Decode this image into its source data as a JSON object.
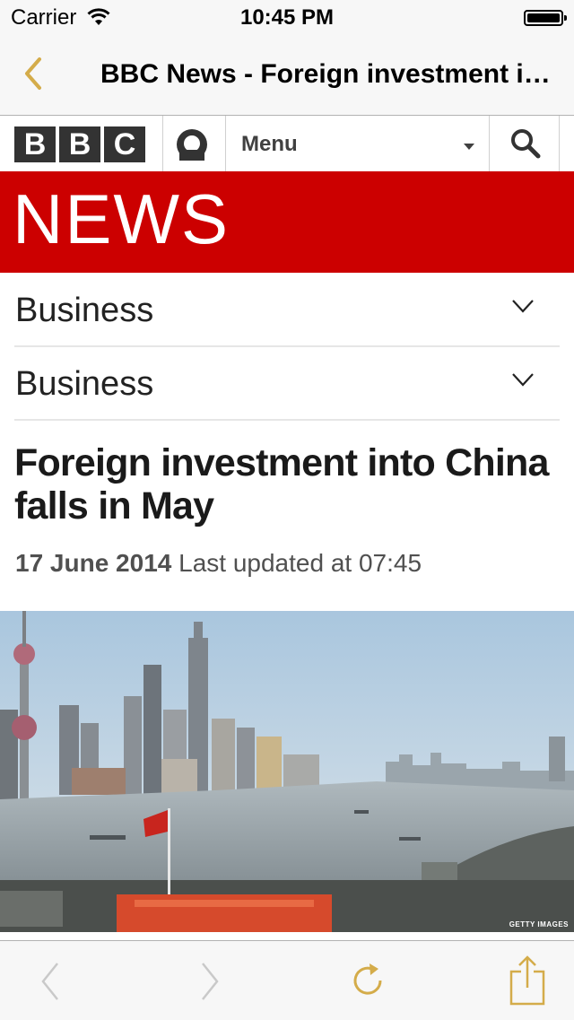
{
  "status_bar": {
    "carrier": "Carrier",
    "time": "10:45 PM",
    "battery_level": 1.0
  },
  "nav": {
    "title": "BBC News - Foreign investment into China falls in May",
    "back_icon": "chevron-left-icon",
    "accent_color": "#d4ac4a"
  },
  "bbc_header": {
    "logo_letters": [
      "B",
      "B",
      "C"
    ],
    "menu_label": "Menu",
    "id_icon": "user-account-icon",
    "search_icon": "search-icon"
  },
  "banner": {
    "text": "NEWS",
    "color": "#cc0000"
  },
  "sections": [
    {
      "label": "Business"
    },
    {
      "label": "Business"
    }
  ],
  "article": {
    "headline": "Foreign investment into China falls in May",
    "date": "17 June 2014",
    "updated": "Last updated at 07:45",
    "image_credit": "GETTY IMAGES"
  },
  "toolbar": {
    "back_icon": "chevron-left-icon",
    "forward_icon": "chevron-right-icon",
    "reload_icon": "reload-icon",
    "share_icon": "share-icon"
  }
}
